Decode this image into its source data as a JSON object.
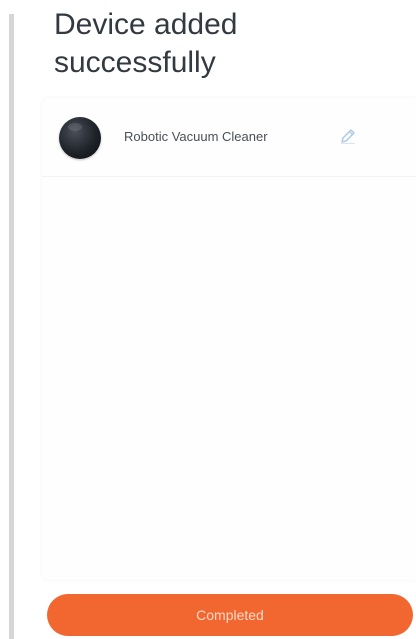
{
  "page": {
    "title": "Device added\nsuccessfully"
  },
  "device": {
    "name": "Robotic Vacuum Cleaner",
    "avatar_icon": "robot-vacuum-icon",
    "edit_icon": "pencil-icon"
  },
  "footer": {
    "done_label": "Completed"
  },
  "colors": {
    "accent": "#f2662f",
    "title_text": "#333940",
    "edit_icon": "#a9c7e6"
  }
}
